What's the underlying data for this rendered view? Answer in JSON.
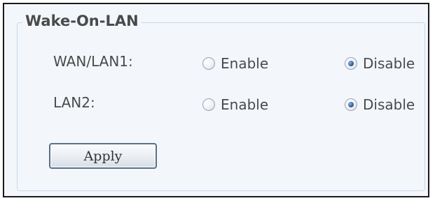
{
  "section": {
    "title": "Wake-On-LAN"
  },
  "rows": [
    {
      "label": "WAN/LAN1:",
      "options": [
        {
          "label": "Enable",
          "checked": false
        },
        {
          "label": "Disable",
          "checked": true
        }
      ]
    },
    {
      "label": "LAN2:",
      "options": [
        {
          "label": "Enable",
          "checked": false
        },
        {
          "label": "Disable",
          "checked": true
        }
      ]
    }
  ],
  "actions": {
    "apply_label": "Apply"
  },
  "colors": {
    "panel_background": "#f3f7fc",
    "text": "#4a4a4a",
    "radio_selected": "#2f5f9f"
  }
}
